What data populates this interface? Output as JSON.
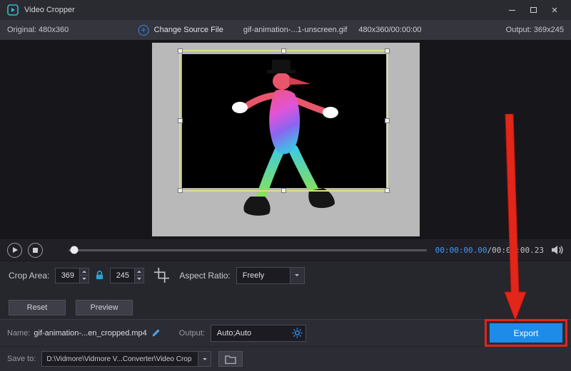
{
  "window": {
    "title": "Video Cropper"
  },
  "icons": {
    "close": "✕",
    "plus": "+"
  },
  "toolbar": {
    "original": "Original: 480x360",
    "change_source": "Change Source File",
    "file_name": "gif-animation-...1-unscreen.gif",
    "file_meta": "480x360/00:00:00",
    "output": "Output: 369x245"
  },
  "player": {
    "time_current": "00:00:00.00",
    "time_total": "/00:00:00.23"
  },
  "crop_controls": {
    "area_label": "Crop Area:",
    "width_value": "369",
    "height_value": "245",
    "aspect_label": "Aspect Ratio:",
    "aspect_value": "Freely"
  },
  "actions": {
    "reset": "Reset",
    "preview": "Preview"
  },
  "output_bar": {
    "name_label": "Name:",
    "name_value": "gif-animation-...en_cropped.mp4",
    "output_label": "Output:",
    "output_value": "Auto;Auto",
    "export": "Export"
  },
  "save_bar": {
    "label": "Save to:",
    "path": "D:\\Vidmore\\Vidmore V...Converter\\Video Crop"
  },
  "colors": {
    "accent_blue": "#2d8cf0",
    "export_blue": "#1d8ce8",
    "annotation_red": "#e1251b",
    "crop_border_yellow": "#dede8a"
  }
}
